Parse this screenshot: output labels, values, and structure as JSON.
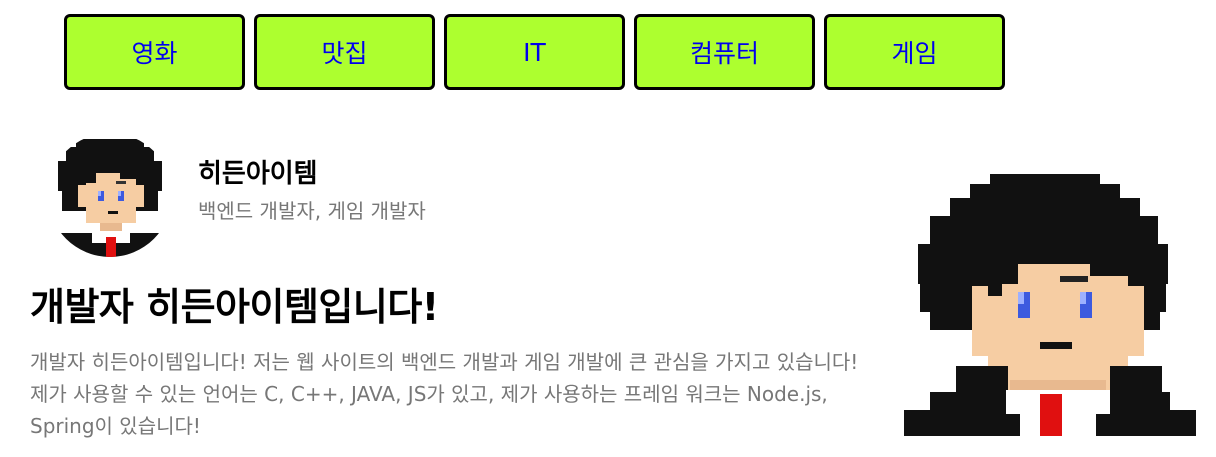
{
  "nav": {
    "items": [
      {
        "label": "영화"
      },
      {
        "label": "맛집"
      },
      {
        "label": "IT"
      },
      {
        "label": "컴퓨터"
      },
      {
        "label": "게임"
      }
    ]
  },
  "profile": {
    "name": "히든아이템",
    "role": "백엔드 개발자, 게임 개발자",
    "avatar_icon": "pixel-character-avatar-icon"
  },
  "main": {
    "headline": "개발자 히든아이템입니다!",
    "intro": "개발자 히든아이템입니다! 저는 웹 사이트의 백엔드 개발과 게임 개발에 큰 관심을 가지고 있습니다! 제가 사용할 수 있는 언어는 C, C++, JAVA, JS가 있고, 제가 사용하는 프레임 워크는 Node.js, Spring이 있습니다!"
  },
  "hero_icon": "pixel-character-portrait-icon",
  "colors": {
    "nav_bg": "#adff2f",
    "nav_text": "#0000ee",
    "skin": "#f6cda3",
    "hair": "#111111",
    "eye": "#3d5adf",
    "tie": "#e01010"
  }
}
